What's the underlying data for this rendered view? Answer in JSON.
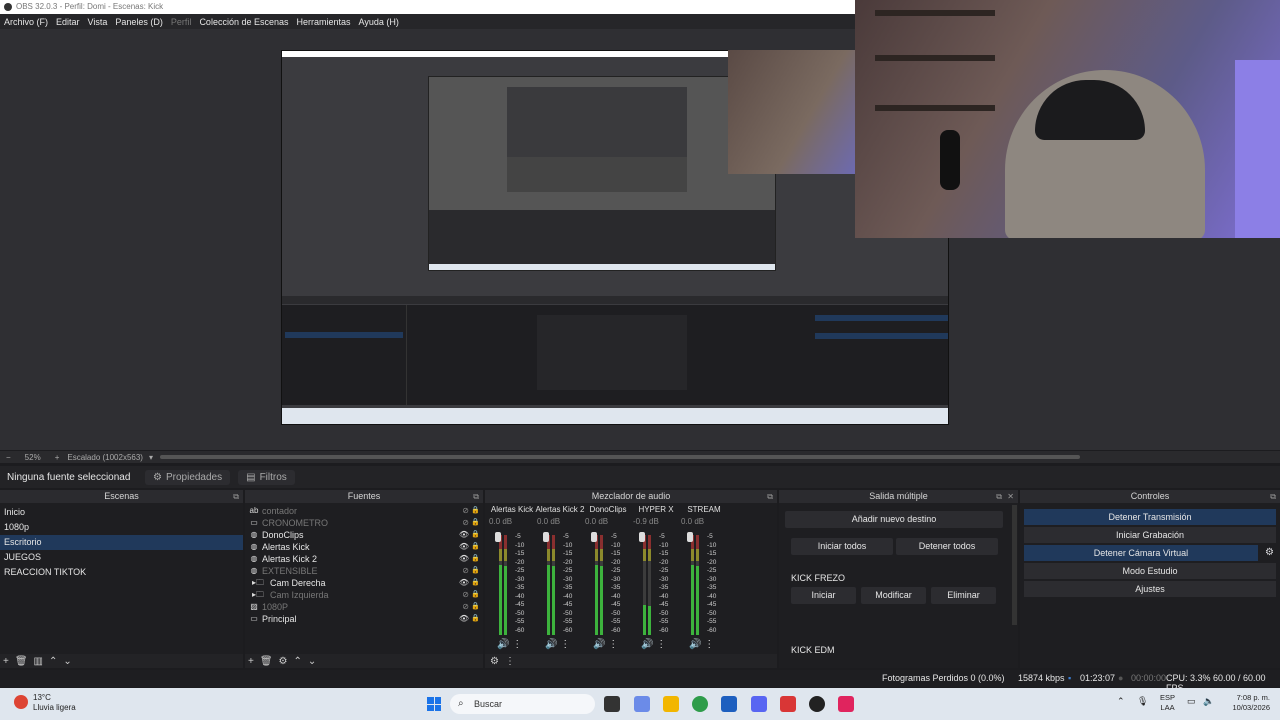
{
  "window": {
    "title": "OBS 32.0.3 - Perfil: Domi - Escenas: Kick"
  },
  "menu": [
    "Archivo (F)",
    "Editar",
    "Vista",
    "Paneles (D)",
    "Perfil",
    "Colección de Escenas",
    "Herramientas",
    "Ayuda (H)"
  ],
  "preview": {
    "zoom": "52%",
    "scale_label": "Escalado (1002x563)"
  },
  "source_toolbar": {
    "no_source": "Ninguna fuente seleccionad",
    "properties": "Propiedades",
    "filters": "Filtros"
  },
  "scenes": {
    "title": "Escenas",
    "items": [
      "Inicio",
      "1080p",
      "Escritorio",
      "JUEGOS",
      "REACCION TIKTOK"
    ],
    "active_index": 2
  },
  "sources": {
    "title": "Fuentes",
    "items": [
      {
        "name": "contador",
        "icon": "text-icon",
        "visible": false
      },
      {
        "name": "CRONOMETRO",
        "icon": "display-icon",
        "visible": false
      },
      {
        "name": "DonoClips",
        "icon": "browser-icon",
        "visible": true
      },
      {
        "name": "Alertas Kick",
        "icon": "browser-icon",
        "visible": true
      },
      {
        "name": "Alertas Kick 2",
        "icon": "browser-icon",
        "visible": true
      },
      {
        "name": "EXTENSIBLE",
        "icon": "browser-icon",
        "visible": false
      },
      {
        "name": "Cam Derecha",
        "icon": "folder-icon",
        "visible": true
      },
      {
        "name": "Cam Izquierda",
        "icon": "folder-icon",
        "visible": false
      },
      {
        "name": "1080P",
        "icon": "image-icon",
        "visible": false
      },
      {
        "name": "Principal",
        "icon": "display-icon",
        "visible": true
      }
    ]
  },
  "mixer": {
    "title": "Mezclador de audio",
    "scale": [
      "-5",
      "-10",
      "-15",
      "-20",
      "-25",
      "-30",
      "-35",
      "-40",
      "-45",
      "-50",
      "-55",
      "-60"
    ],
    "channels": [
      {
        "name": "Alertas Kick",
        "db": "0.0 dB",
        "level": 0.7
      },
      {
        "name": "Alertas Kick 2",
        "db": "0.0 dB",
        "level": 0.7
      },
      {
        "name": "DonoClips",
        "db": "0.0 dB",
        "level": 0.7
      },
      {
        "name": "HYPER X",
        "db": "-0.9 dB",
        "level": 0.3
      },
      {
        "name": "STREAM",
        "db": "0.0 dB",
        "level": 0.7
      }
    ]
  },
  "multi_output": {
    "title": "Salida múltiple",
    "add_target": "Añadir nuevo destino",
    "start_all": "Iniciar todos",
    "stop_all": "Detener todos",
    "targets": [
      {
        "name": "KICK FREZO",
        "start": "Iniciar",
        "edit": "Modificar",
        "delete": "Eliminar"
      },
      {
        "name": "KICK EDM"
      }
    ]
  },
  "controls": {
    "title": "Controles",
    "buttons": [
      "Detener Transmisión",
      "Iniciar Grabación",
      "Detener Cámara Virtual",
      "Modo Estudio",
      "Ajustes"
    ]
  },
  "status": {
    "dropped": "Fotogramas Perdidos 0 (0.0%)",
    "bitrate": "15874 kbps",
    "stream_time": "01:23:07",
    "rec_time": "00:00:00",
    "cpu": "CPU: 3.3% 60.00 / 60.00 FPS"
  },
  "taskbar": {
    "temp": "13°C",
    "weather": "Lluvia ligera",
    "search": "Buscar",
    "lang1": "ESP",
    "lang2": "LAA",
    "time": "7:08 p. m.",
    "date": "10/03/2026"
  },
  "colors": {
    "accent": "#20395b",
    "meter_green": "#3db33d",
    "meter_red": "#8a2f2f"
  }
}
